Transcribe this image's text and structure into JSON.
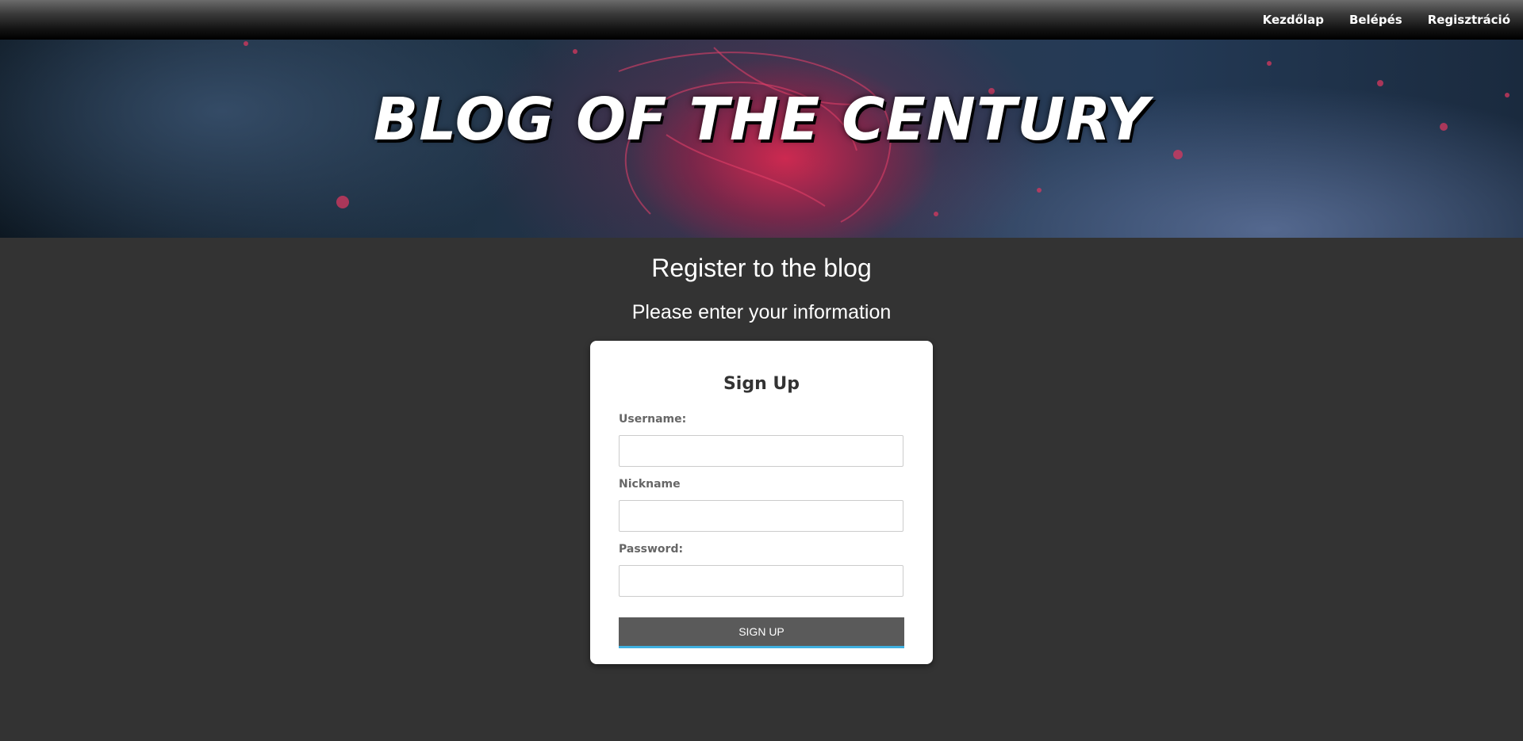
{
  "nav": {
    "items": [
      {
        "label": "Kezdőlap"
      },
      {
        "label": "Belépés"
      },
      {
        "label": "Regisztráció"
      }
    ]
  },
  "banner": {
    "title": "BLOG OF THE CENTURY"
  },
  "page": {
    "heading": "Register to the blog",
    "subheading": "Please enter your information"
  },
  "form": {
    "title": "Sign Up",
    "fields": [
      {
        "label": "Username:",
        "value": "",
        "placeholder": ""
      },
      {
        "label": "Nickname",
        "value": "",
        "placeholder": ""
      },
      {
        "label": "Password:",
        "value": "",
        "placeholder": ""
      }
    ],
    "submit_label": "SIGN UP"
  },
  "colors": {
    "page_background": "#333333",
    "button_background": "#5a5a5a",
    "button_accent": "#3fb0e0"
  }
}
